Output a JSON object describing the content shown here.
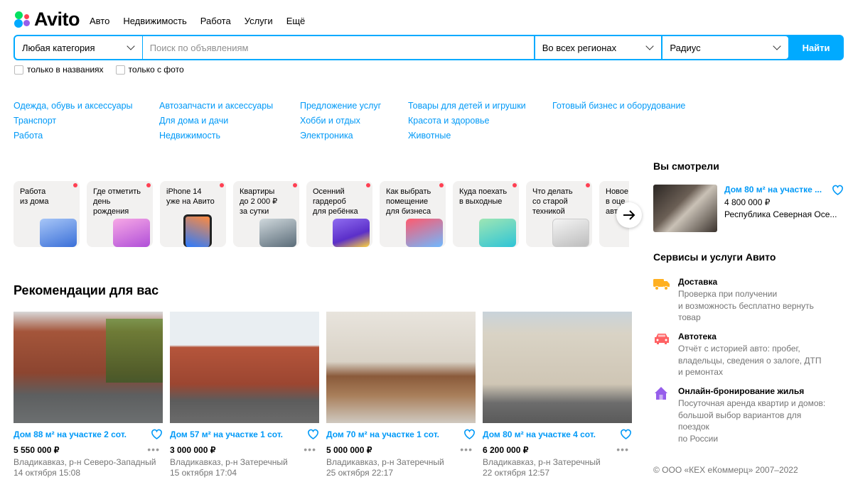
{
  "brand": {
    "name": "Avito"
  },
  "topnav": [
    "Авто",
    "Недвижимость",
    "Работа",
    "Услуги",
    "Ещё"
  ],
  "search": {
    "category": "Любая категория",
    "placeholder": "Поиск по объявлениям",
    "region": "Во всех регионах",
    "radius": "Радиус",
    "button": "Найти"
  },
  "filters": {
    "titles_only": "только в названиях",
    "with_photo": "только с фото"
  },
  "categories": [
    [
      "Одежда, обувь и аксессуары",
      "Транспорт",
      "Работа"
    ],
    [
      "Автозапчасти и аксессуары",
      "Для дома и дачи",
      "Недвижимость"
    ],
    [
      "Предложение услуг",
      "Хобби и отдых",
      "Электроника"
    ],
    [
      "Товары для детей и игрушки",
      "Красота и здоровье",
      "Животные"
    ],
    [
      "Готовый бизнес и оборудование"
    ]
  ],
  "stories": [
    {
      "label": "Работа из дома",
      "l1": "Работа",
      "l2": "из дома",
      "l3": ""
    },
    {
      "label": "Где отметить день рождения",
      "l1": "Где отметить",
      "l2": "день",
      "l3": "рождения"
    },
    {
      "label": "iPhone 14 уже на Авито",
      "l1": "iPhone 14",
      "l2": "уже на Авито",
      "l3": ""
    },
    {
      "label": "Квартиры до 2 000 ₽ за сутки",
      "l1": "Квартиры",
      "l2": "до 2 000 ₽",
      "l3": "за сутки"
    },
    {
      "label": "Осенний гардероб для ребёнка",
      "l1": "Осенний",
      "l2": "гардероб",
      "l3": "для ребёнка"
    },
    {
      "label": "Как выбрать помещение для бизнеса",
      "l1": "Как выбрать",
      "l2": "помещение",
      "l3": "для бизнеса"
    },
    {
      "label": "Куда поехать в выходные",
      "l1": "Куда поехать",
      "l2": "в выходные",
      "l3": ""
    },
    {
      "label": "Что делать со старой техникой",
      "l1": "Что делать",
      "l2": "со старой",
      "l3": "техникой"
    },
    {
      "label": "Новое в оценке авто",
      "l1": "Новое",
      "l2": "в оце",
      "l3": "авт"
    }
  ],
  "recommendations": {
    "title": "Рекомендации для вас",
    "cards": [
      {
        "title": "Дом 88 м² на участке 2 сот.",
        "price": "5 550 000 ₽",
        "location": "Владикавказ, р-н Северо-Западный",
        "date": "14 октября 15:08"
      },
      {
        "title": "Дом 57 м² на участке 1 сот.",
        "price": "3 000 000 ₽",
        "location": "Владикавказ, р-н Затеречный",
        "date": "15 октября 17:04"
      },
      {
        "title": "Дом 70 м² на участке 1 сот.",
        "price": "5 000 000 ₽",
        "location": "Владикавказ, р-н Затеречный",
        "date": "25 октября 22:17"
      },
      {
        "title": "Дом 80 м² на участке 4 сот.",
        "price": "6 200 000 ₽",
        "location": "Владикавказ, р-н Затеречный",
        "date": "22 октября 12:57"
      }
    ]
  },
  "viewed": {
    "title": "Вы смотрели",
    "item": {
      "title": "Дом 80 м² на участке ...",
      "price": "4 800 000 ₽",
      "region": "Республика Северная Осе..."
    }
  },
  "services": {
    "title": "Сервисы и услуги Авито",
    "items": [
      {
        "name": "Доставка",
        "desc1": "Проверка при получении",
        "desc2": "и возможность бесплатно вернуть",
        "desc3": "товар",
        "icon": "truck-icon",
        "color": "#ffb021"
      },
      {
        "name": "Автотека",
        "desc1": "Отчёт с историей авто: пробег,",
        "desc2": "владельцы, сведения о залоге, ДТП",
        "desc3": "и ремонтах",
        "icon": "car-icon",
        "color": "#ff6163"
      },
      {
        "name": "Онлайн-бронирование жилья",
        "desc1": "Посуточная аренда квартир и домов:",
        "desc2": "большой выбор вариантов для поездок",
        "desc3": "по России",
        "icon": "house-icon",
        "color": "#965eeb"
      }
    ]
  },
  "footer": {
    "copyright": "© ООО «КЕХ еКоммерц» 2007–2022"
  },
  "colors": {
    "accent": "#00aaff",
    "link": "#0099f7",
    "muted": "#757575",
    "badge": "#ff4053"
  }
}
